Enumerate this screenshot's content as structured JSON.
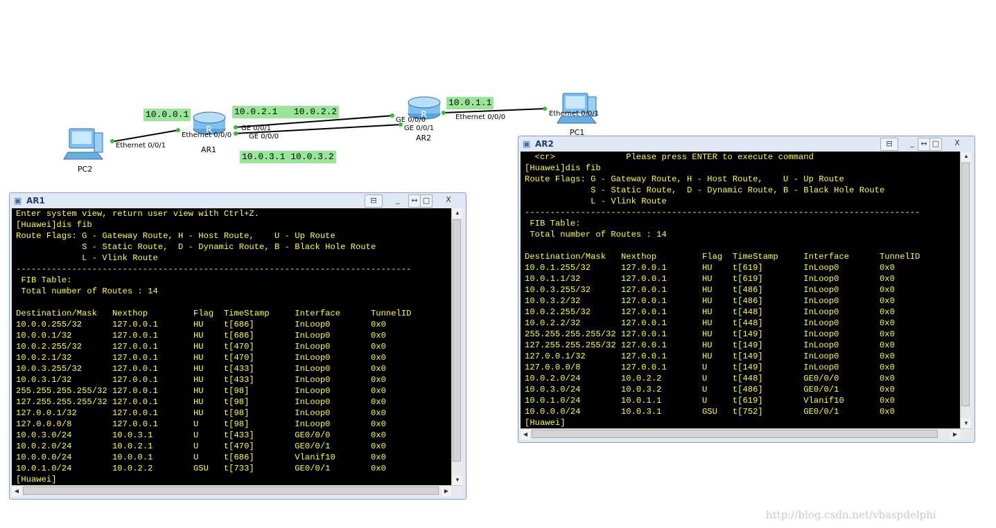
{
  "topology": {
    "devices": {
      "pc2": "PC2",
      "ar1": "AR1",
      "ar2": "AR2",
      "pc1": "PC1"
    },
    "ports": {
      "pc2_eth": "Ethernet 0/0/1",
      "ar1_eth": "Ethernet 0/0/0",
      "ar1_ge1": "GE 0/0/1",
      "ar1_ge0": "GE 0/0/0",
      "ar2_ge0": "GE 0/0/0",
      "ar2_ge1": "GE 0/0/1",
      "ar2_eth": "Ethernet 0/0/0",
      "pc1_eth": "Ethernet 0/0/1"
    },
    "ips": {
      "pc2": "10.0.0.1",
      "link2": "10.0.2.1   10.0.2.2",
      "pc1": "10.0.1.1",
      "link3": "10.0.3.1 10.0.3.2"
    }
  },
  "ar1_window": {
    "title": "AR1",
    "buttons": {
      "restore": "⊟",
      "min": "_",
      "arrows": "↔",
      "max": "□",
      "close": "X"
    },
    "lines": [
      "Enter system view, return user view with Ctrl+Z.",
      "[Huawei]dis fib",
      "Route Flags: G - Gateway Route, H - Host Route,    U - Up Route",
      "             S - Static Route,  D - Dynamic Route, B - Black Hole Route",
      "             L - Vlink Route",
      "------------------------------------------------------------------------------",
      " FIB Table:",
      " Total number of Routes : 14",
      "",
      "Destination/Mask   Nexthop         Flag  TimeStamp     Interface      TunnelID",
      "10.0.0.255/32      127.0.0.1       HU    t[686]        InLoop0        0x0",
      "10.0.0.1/32        127.0.0.1       HU    t[686]        InLoop0        0x0",
      "10.0.2.255/32      127.0.0.1       HU    t[470]        InLoop0        0x0",
      "10.0.2.1/32        127.0.0.1       HU    t[470]        InLoop0        0x0",
      "10.0.3.255/32      127.0.0.1       HU    t[433]        InLoop0        0x0",
      "10.0.3.1/32        127.0.0.1       HU    t[433]        InLoop0        0x0",
      "255.255.255.255/32 127.0.0.1       HU    t[98]         InLoop0        0x0",
      "127.255.255.255/32 127.0.0.1       HU    t[98]         InLoop0        0x0",
      "127.0.0.1/32       127.0.0.1       HU    t[98]         InLoop0        0x0",
      "127.0.0.0/8        127.0.0.1       U     t[98]         InLoop0        0x0",
      "10.0.3.0/24        10.0.3.1        U     t[433]        GE0/0/0        0x0",
      "10.0.2.0/24        10.0.2.1        U     t[470]        GE0/0/1        0x0",
      "10.0.0.0/24        10.0.0.1        U     t[686]        Vlanif10       0x0",
      "10.0.1.0/24        10.0.2.2        GSU   t[733]        GE0/0/1        0x0",
      "[Huawei]"
    ]
  },
  "ar2_window": {
    "title": "AR2",
    "buttons": {
      "restore": "⊟",
      "min": "_",
      "arrows": "↔",
      "max": "□",
      "close": "X"
    },
    "lines": [
      "  <cr>              Please press ENTER to execute command",
      "[Huawei]dis fib",
      "Route Flags: G - Gateway Route, H - Host Route,    U - Up Route",
      "             S - Static Route,  D - Dynamic Route, B - Black Hole Route",
      "             L - Vlink Route",
      "------------------------------------------------------------------------------",
      " FIB Table:",
      " Total number of Routes : 14",
      "",
      "Destination/Mask   Nexthop         Flag  TimeStamp     Interface      TunnelID",
      "10.0.1.255/32      127.0.0.1       HU    t[619]        InLoop0        0x0",
      "10.0.1.1/32        127.0.0.1       HU    t[619]        InLoop0        0x0",
      "10.0.3.255/32      127.0.0.1       HU    t[486]        InLoop0        0x0",
      "10.0.3.2/32        127.0.0.1       HU    t[486]        InLoop0        0x0",
      "10.0.2.255/32      127.0.0.1       HU    t[448]        InLoop0        0x0",
      "10.0.2.2/32        127.0.0.1       HU    t[448]        InLoop0        0x0",
      "255.255.255.255/32 127.0.0.1       HU    t[149]        InLoop0        0x0",
      "127.255.255.255/32 127.0.0.1       HU    t[149]        InLoop0        0x0",
      "127.0.0.1/32       127.0.0.1       HU    t[149]        InLoop0        0x0",
      "127.0.0.0/8        127.0.0.1       U     t[149]        InLoop0        0x0",
      "10.0.2.0/24        10.0.2.2        U     t[448]        GE0/0/0        0x0",
      "10.0.3.0/24        10.0.3.2        U     t[486]        GE0/0/1        0x0",
      "10.0.1.0/24        10.0.1.1        U     t[619]        Vlanif10       0x0",
      "10.0.0.0/24        10.0.3.1        GSU   t[752]        GE0/0/1        0x0",
      "[Huawei]"
    ]
  },
  "watermark": "http://blog.csdn.net/vbaspdelphi"
}
